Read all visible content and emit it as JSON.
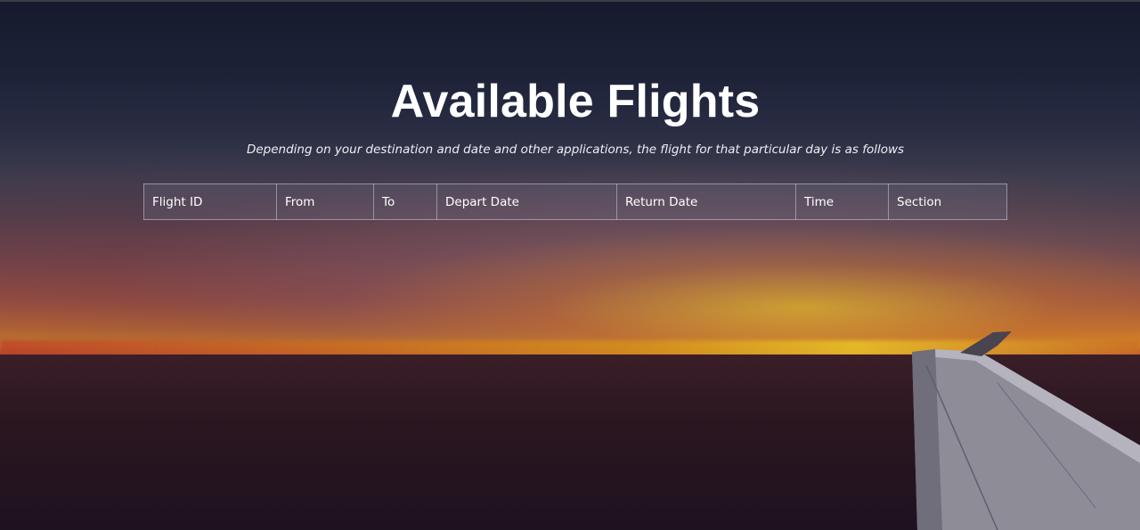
{
  "page": {
    "title": "Available Flights",
    "subtitle": "Depending on your destination and date and other applications, the flight for that particular day is as follows"
  },
  "table": {
    "columns": [
      "Flight ID",
      "From",
      "To",
      "Depart Date",
      "Return Date",
      "Time",
      "Section"
    ],
    "rows": []
  },
  "background": {
    "scene": "sunset-over-sea-from-airplane-window",
    "colors": {
      "sky_top": "#1d2236",
      "horizon": "#d88a24",
      "sea": "#2a1620"
    }
  }
}
